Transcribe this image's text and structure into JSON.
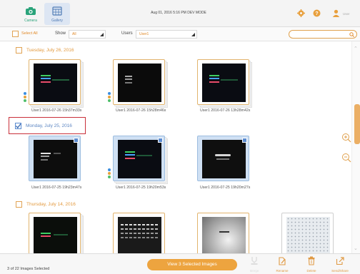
{
  "nav": {
    "camera_label": "Camera",
    "gallery_label": "Gallery",
    "status": "Aug 01, 2016  5:16 PM DEV MODE",
    "user": "User"
  },
  "filters": {
    "select_all_label": "Select All",
    "show_label": "Show",
    "show_value": "All",
    "users_label": "Users",
    "users_value": "User1",
    "search_placeholder": ""
  },
  "groups": [
    {
      "date": "Tuesday, July 26, 2016",
      "selected": false,
      "images": [
        {
          "caption": "User1 2016-07-26 15h37m33s",
          "selected": false
        },
        {
          "caption": "User1 2016-07-26 15h28m46s",
          "selected": false
        },
        {
          "caption": "User1 2016-07-26 13h28m42s",
          "selected": false
        }
      ]
    },
    {
      "date": "Monday, July 25, 2016",
      "selected": true,
      "images": [
        {
          "caption": "User1 2016-07-25 19h23m47s",
          "selected": true
        },
        {
          "caption": "User1 2016-07-25 19h20m53s",
          "selected": true
        },
        {
          "caption": "User1 2016-07-25 19h20m27s",
          "selected": true
        }
      ]
    },
    {
      "date": "Thursday, July 14, 2016",
      "selected": false,
      "images": [
        {
          "caption": "",
          "selected": false
        },
        {
          "caption": "",
          "selected": false
        },
        {
          "caption": "",
          "selected": false
        },
        {
          "caption": "",
          "selected": false
        }
      ]
    }
  ],
  "footer": {
    "selection_count": "3 of 22 Images Selected",
    "view_button": "View 3 Selected Images",
    "merge_label": "Merge",
    "rename_label": "Rename",
    "delete_label": "Delete",
    "send_label": "Send/Share"
  },
  "colors": {
    "accent": "#eda43f",
    "selection": "#5b8bd0",
    "highlight_box": "#c9303a"
  }
}
